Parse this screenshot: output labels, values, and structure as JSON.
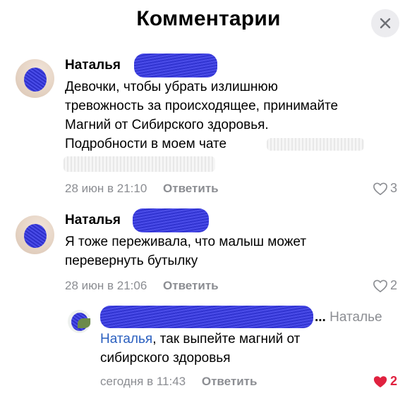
{
  "header": {
    "title": "Комментарии",
    "close_icon": "close-icon"
  },
  "comments": [
    {
      "author": "Наталья",
      "text_lines": [
        "Девочки, чтобы убрать излишнюю",
        "тревожность за происходящее, принимайте",
        "Магний от Сибирского здоровья.",
        "Подробности в моем чате"
      ],
      "time": "28 июн в 21:10",
      "reply_label": "Ответить",
      "likes": "3"
    },
    {
      "author": "Наталья",
      "text_lines": [
        "Я тоже переживала, что малыш может",
        "перевернуть бутылку"
      ],
      "time": "28 июн в 21:06",
      "reply_label": "Ответить",
      "likes": "2"
    }
  ],
  "reply": {
    "ellipsis": "...",
    "to": "Наталье",
    "mention": "Наталья",
    "text_first": ", так выпейте магний от",
    "text_second": "сибирского здоровья",
    "time": "сегодня в 11:43",
    "reply_label": "Ответить",
    "likes": "2"
  },
  "colors": {
    "accent_link": "#2a5fbf",
    "liked_heart": "#e0213f",
    "muted": "#8b8d92"
  }
}
